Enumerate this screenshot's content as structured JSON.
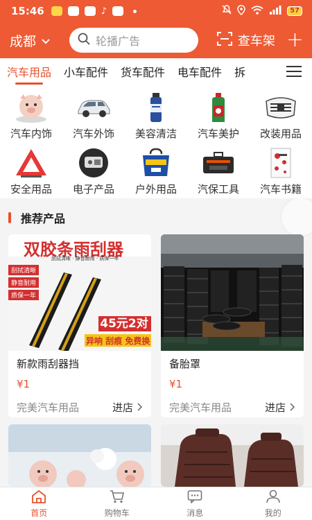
{
  "status_bar": {
    "time": "15:46",
    "battery": "57"
  },
  "top_nav": {
    "city": "成都",
    "search_placeholder": "轮播广告",
    "garage_label": "查车架"
  },
  "tabs": [
    "汽车用品",
    "小车配件",
    "货车配件",
    "电车配件",
    "拆"
  ],
  "categories": [
    {
      "label": "汽车内饰",
      "icon": "piglet-ornament-icon"
    },
    {
      "label": "汽车外饰",
      "icon": "car-icon"
    },
    {
      "label": "美容清洁",
      "icon": "spray-can-icon"
    },
    {
      "label": "汽车美护",
      "icon": "oil-bottle-icon"
    },
    {
      "label": "改装用品",
      "icon": "grille-icon"
    },
    {
      "label": "安全用品",
      "icon": "warning-triangle-icon"
    },
    {
      "label": "电子产品",
      "icon": "gadget-icon"
    },
    {
      "label": "户外用品",
      "icon": "bag-icon"
    },
    {
      "label": "汽保工具",
      "icon": "toolbox-icon"
    },
    {
      "label": "汽车书籍",
      "icon": "book-icon"
    }
  ],
  "recommend": {
    "title": "推荐产品",
    "products": [
      {
        "name": "新款雨刮器挡",
        "price": "¥1",
        "shop": "完美汽车用品",
        "go_label": "进店",
        "image_text": {
          "headline": "双胶条雨刮器",
          "sub": "刮拭清晰 · 静音耐用 · 质保一年",
          "tags": [
            "刮拭清晰",
            "静音耐用",
            "质保一年"
          ],
          "badge": "45元2对",
          "footer": "异响 刮痕 免费换"
        }
      },
      {
        "name": "备胎罩",
        "price": "¥1",
        "shop": "完美汽车用品",
        "go_label": "进店"
      },
      {
        "name": "",
        "price": "",
        "shop": "",
        "go_label": ""
      },
      {
        "name": "",
        "price": "",
        "shop": "",
        "go_label": ""
      }
    ]
  },
  "bottom_nav": [
    {
      "label": "首页",
      "icon": "home-icon",
      "active": true
    },
    {
      "label": "购物车",
      "icon": "cart-icon",
      "active": false
    },
    {
      "label": "消息",
      "icon": "message-icon",
      "active": false
    },
    {
      "label": "我的",
      "icon": "user-icon",
      "active": false
    }
  ],
  "colors": {
    "brand": "#ee5a34",
    "accent": "#e8502d"
  }
}
